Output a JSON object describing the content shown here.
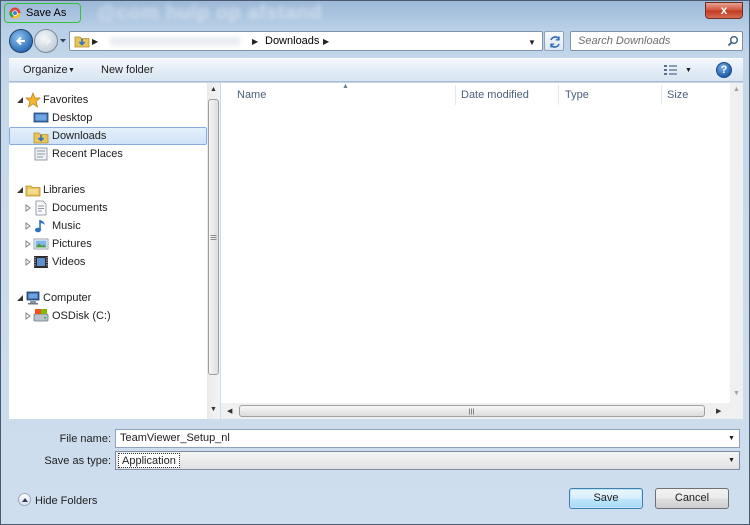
{
  "window": {
    "title": "Save As",
    "blurred_overlay_text": "@com hulp op afstand",
    "close_label": "x"
  },
  "address": {
    "crumb": "Downloads",
    "search_placeholder": "Search Downloads"
  },
  "toolbar": {
    "organize_label": "Organize",
    "new_folder_label": "New folder",
    "help_label": "?"
  },
  "nav": {
    "favorites": {
      "label": "Favorites",
      "items": [
        {
          "label": "Desktop"
        },
        {
          "label": "Downloads",
          "selected": true
        },
        {
          "label": "Recent Places"
        }
      ]
    },
    "libraries": {
      "label": "Libraries",
      "items": [
        {
          "label": "Documents"
        },
        {
          "label": "Music"
        },
        {
          "label": "Pictures"
        },
        {
          "label": "Videos"
        }
      ]
    },
    "computer": {
      "label": "Computer",
      "items": [
        {
          "label": "OSDisk (C:)"
        }
      ]
    }
  },
  "filelist": {
    "columns": [
      "Name",
      "Date modified",
      "Type",
      "Size"
    ],
    "rows": []
  },
  "form": {
    "file_name_label": "File name:",
    "file_name_value": "TeamViewer_Setup_nl",
    "save_type_label": "Save as type:",
    "save_type_value": "Application"
  },
  "footer": {
    "hide_folders_label": "Hide Folders",
    "save_label": "Save",
    "cancel_label": "Cancel"
  }
}
